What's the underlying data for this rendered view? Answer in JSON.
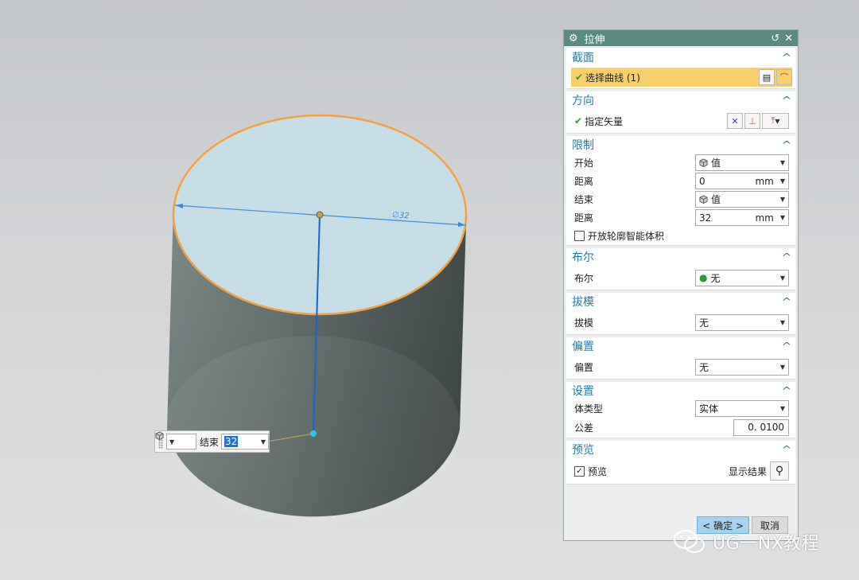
{
  "viewport": {
    "dimension_text": "∅32",
    "mini_toolbar": {
      "end_label": "结束",
      "end_value": "32"
    }
  },
  "dialog": {
    "title": "拉伸",
    "sections": {
      "section": {
        "title": "截面",
        "select_curve": "选择曲线 (1)"
      },
      "direction": {
        "title": "方向",
        "specify_vector": "指定矢量"
      },
      "limits": {
        "title": "限制",
        "start_label": "开始",
        "start_value": "值",
        "start_distance_label": "距离",
        "start_distance": "0",
        "unit1": "mm",
        "end_label": "结束",
        "end_value": "值",
        "end_distance_label": "距离",
        "end_distance": "32",
        "unit2": "mm",
        "open_profile": "开放轮廓智能体积"
      },
      "boolean": {
        "title": "布尔",
        "label": "布尔",
        "value": "无"
      },
      "draft": {
        "title": "拔模",
        "label": "拔模",
        "value": "无"
      },
      "offset": {
        "title": "偏置",
        "label": "偏置",
        "value": "无"
      },
      "settings": {
        "title": "设置",
        "body_type_label": "体类型",
        "body_type": "实体",
        "tolerance_label": "公差",
        "tolerance": "0. 0100"
      },
      "preview": {
        "title": "预览",
        "preview_label": "预览",
        "show_result": "显示结果"
      }
    },
    "buttons": {
      "ok": "< 确定 >",
      "cancel": "取消"
    }
  },
  "watermark": {
    "text": "UG一NX教程"
  },
  "colors": {
    "title_bar": "#5b8a82",
    "section_title": "#2a7aa8",
    "highlight": "#f7cf6b",
    "edge": "#f5a040"
  }
}
